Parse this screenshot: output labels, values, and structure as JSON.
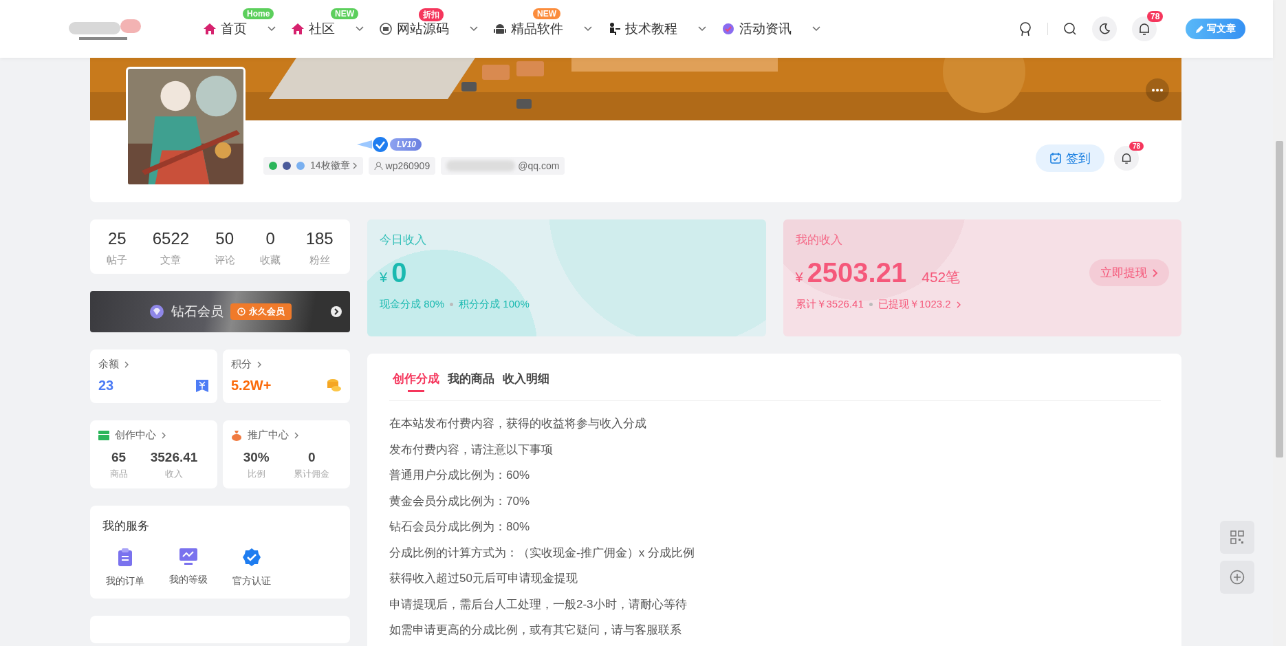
{
  "nav": {
    "items": [
      {
        "label": "首页",
        "badge": "Home",
        "color": "#5ccf5c"
      },
      {
        "label": "社区",
        "badge": "NEW",
        "color": "#5ccf5c"
      },
      {
        "label": "网站源码",
        "badge": "折扣",
        "color": "#f5365c"
      },
      {
        "label": "精品软件",
        "badge": "NEW",
        "color": "#fb8c3c"
      },
      {
        "label": "技术教程"
      },
      {
        "label": "活动资讯"
      }
    ],
    "notifications": "78",
    "write_button": "写文章"
  },
  "profile": {
    "verified": true,
    "level": "LV10",
    "badges": "14枚徽章",
    "username": "wp260909",
    "email": "@qq.com",
    "sign_button": "签到",
    "notifications": "78"
  },
  "stats": [
    {
      "value": "25",
      "label": "帖子"
    },
    {
      "value": "6522",
      "label": "文章"
    },
    {
      "value": "50",
      "label": "评论"
    },
    {
      "value": "0",
      "label": "收藏"
    },
    {
      "value": "185",
      "label": "粉丝"
    }
  ],
  "vip": {
    "title": "钻石会员",
    "tag": "永久会员"
  },
  "wallet": [
    {
      "kind": "balance",
      "title": "余额",
      "value": "23"
    },
    {
      "kind": "points",
      "title": "积分",
      "value": "5.2W+"
    }
  ],
  "centers": [
    {
      "kind": "creation",
      "title": "创作中心",
      "stats": [
        {
          "value": "65",
          "label": "商品"
        },
        {
          "value": "3526.41",
          "label": "收入"
        }
      ]
    },
    {
      "kind": "promotion",
      "title": "推广中心",
      "stats": [
        {
          "value": "30%",
          "label": "比例"
        },
        {
          "value": "0",
          "label": "累计佣金"
        }
      ]
    }
  ],
  "services": {
    "title": "我的服务",
    "items": [
      {
        "kind": "orders",
        "label": "我的订单"
      },
      {
        "kind": "level",
        "label": "我的等级"
      },
      {
        "kind": "verify",
        "label": "官方认证"
      }
    ]
  },
  "today_income": {
    "title": "今日收入",
    "currency": "¥",
    "amount": "0",
    "notes": [
      "现金分成 80%",
      "积分分成 100%"
    ]
  },
  "my_income": {
    "title": "我的收入",
    "currency": "¥",
    "amount": "2503.21",
    "count": "452笔",
    "button": "立即提现",
    "notes": [
      "累计￥3526.41",
      "已提现￥1023.2"
    ]
  },
  "tabs": [
    {
      "label": "创作分成",
      "selected": true
    },
    {
      "label": "我的商品",
      "selected": false
    },
    {
      "label": "收入明细",
      "selected": false
    }
  ],
  "lines": [
    "在本站发布付费内容，获得的收益将参与收入分成",
    "发布付费内容，请注意以下事项",
    "普通用户分成比例为：60%",
    "黄金会员分成比例为：70%",
    "钻石会员分成比例为：80%",
    "分成比例的计算方式为：（实收现金-推广佣金）x 分成比例",
    "获得收入超过50元后可申请现金提现",
    "申请提现后，需后台人工处理，一般2-3小时，请耐心等待",
    "如需申请更高的分成比例，或有其它疑问，请与客服联系"
  ]
}
